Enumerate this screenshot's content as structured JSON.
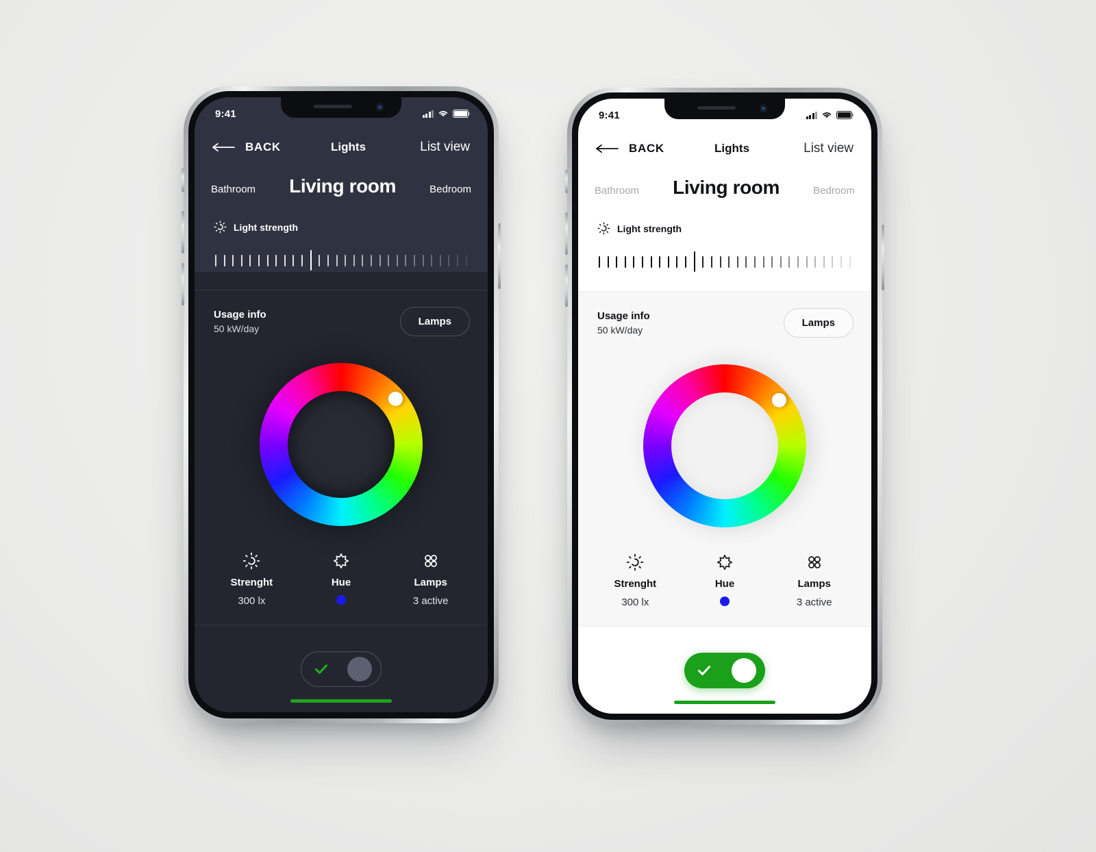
{
  "scene": {
    "background_color": "#ebebea",
    "phone_count": 2
  },
  "theme_colors": {
    "dark_bg": "#23262f",
    "dark_header_bg": "#2f3341",
    "light_bg": "#ffffff",
    "light_panel_bg": "#f7f7f7",
    "accent_green": "#1aa01a",
    "hue_dot_blue": "#1a1aee"
  },
  "phones": [
    {
      "id": "phone-dark",
      "theme": "dark",
      "statusbar": {
        "time": "9:41",
        "signal_icon": "cellular-signal-icon",
        "wifi_icon": "wifi-icon",
        "battery_icon": "battery-icon"
      },
      "nav": {
        "back_icon": "arrow-left-icon",
        "back_label": "BACK",
        "title": "Lights",
        "list_view_label": "List view"
      },
      "rooms": {
        "left": "Bathroom",
        "active": "Living room",
        "right": "Bedroom"
      },
      "strength": {
        "icon": "sun-icon",
        "label": "Light strength",
        "tick_count": 30,
        "active_tick_index": 11
      },
      "usage": {
        "title": "Usage info",
        "value": "50 kW/day",
        "lamps_button": "Lamps"
      },
      "wheel": {
        "name": "color-wheel",
        "handle_angle_deg": 50
      },
      "controls": [
        {
          "icon": "sun-icon",
          "label": "Strenght",
          "value": "300 lx"
        },
        {
          "icon": "star-icon",
          "label": "Hue",
          "value": "",
          "dot_color": "#1a1aee"
        },
        {
          "icon": "lamps-grid-icon",
          "label": "Lamps",
          "value": "3 active"
        }
      ],
      "toggle": {
        "state": "on",
        "check_icon": "check-icon",
        "knob_color": "#5c6070"
      },
      "home_indicator_color": "#22a222"
    },
    {
      "id": "phone-light",
      "theme": "light",
      "statusbar": {
        "time": "9:41",
        "signal_icon": "cellular-signal-icon",
        "wifi_icon": "wifi-icon",
        "battery_icon": "battery-icon"
      },
      "nav": {
        "back_icon": "arrow-left-icon",
        "back_label": "BACK",
        "title": "Lights",
        "list_view_label": "List view"
      },
      "rooms": {
        "left": "Bathroom",
        "active": "Living room",
        "right": "Bedroom"
      },
      "strength": {
        "icon": "sun-icon",
        "label": "Light strength",
        "tick_count": 30,
        "active_tick_index": 11
      },
      "usage": {
        "title": "Usage info",
        "value": "50 kW/day",
        "lamps_button": "Lamps"
      },
      "wheel": {
        "name": "color-wheel",
        "handle_angle_deg": 50
      },
      "controls": [
        {
          "icon": "sun-icon",
          "label": "Strenght",
          "value": "300 lx"
        },
        {
          "icon": "star-icon",
          "label": "Hue",
          "value": "",
          "dot_color": "#1a1aee"
        },
        {
          "icon": "lamps-grid-icon",
          "label": "Lamps",
          "value": "3 active"
        }
      ],
      "toggle": {
        "state": "on",
        "check_icon": "check-icon",
        "knob_color": "#ffffff"
      },
      "home_indicator_color": "#1aa01a"
    }
  ]
}
